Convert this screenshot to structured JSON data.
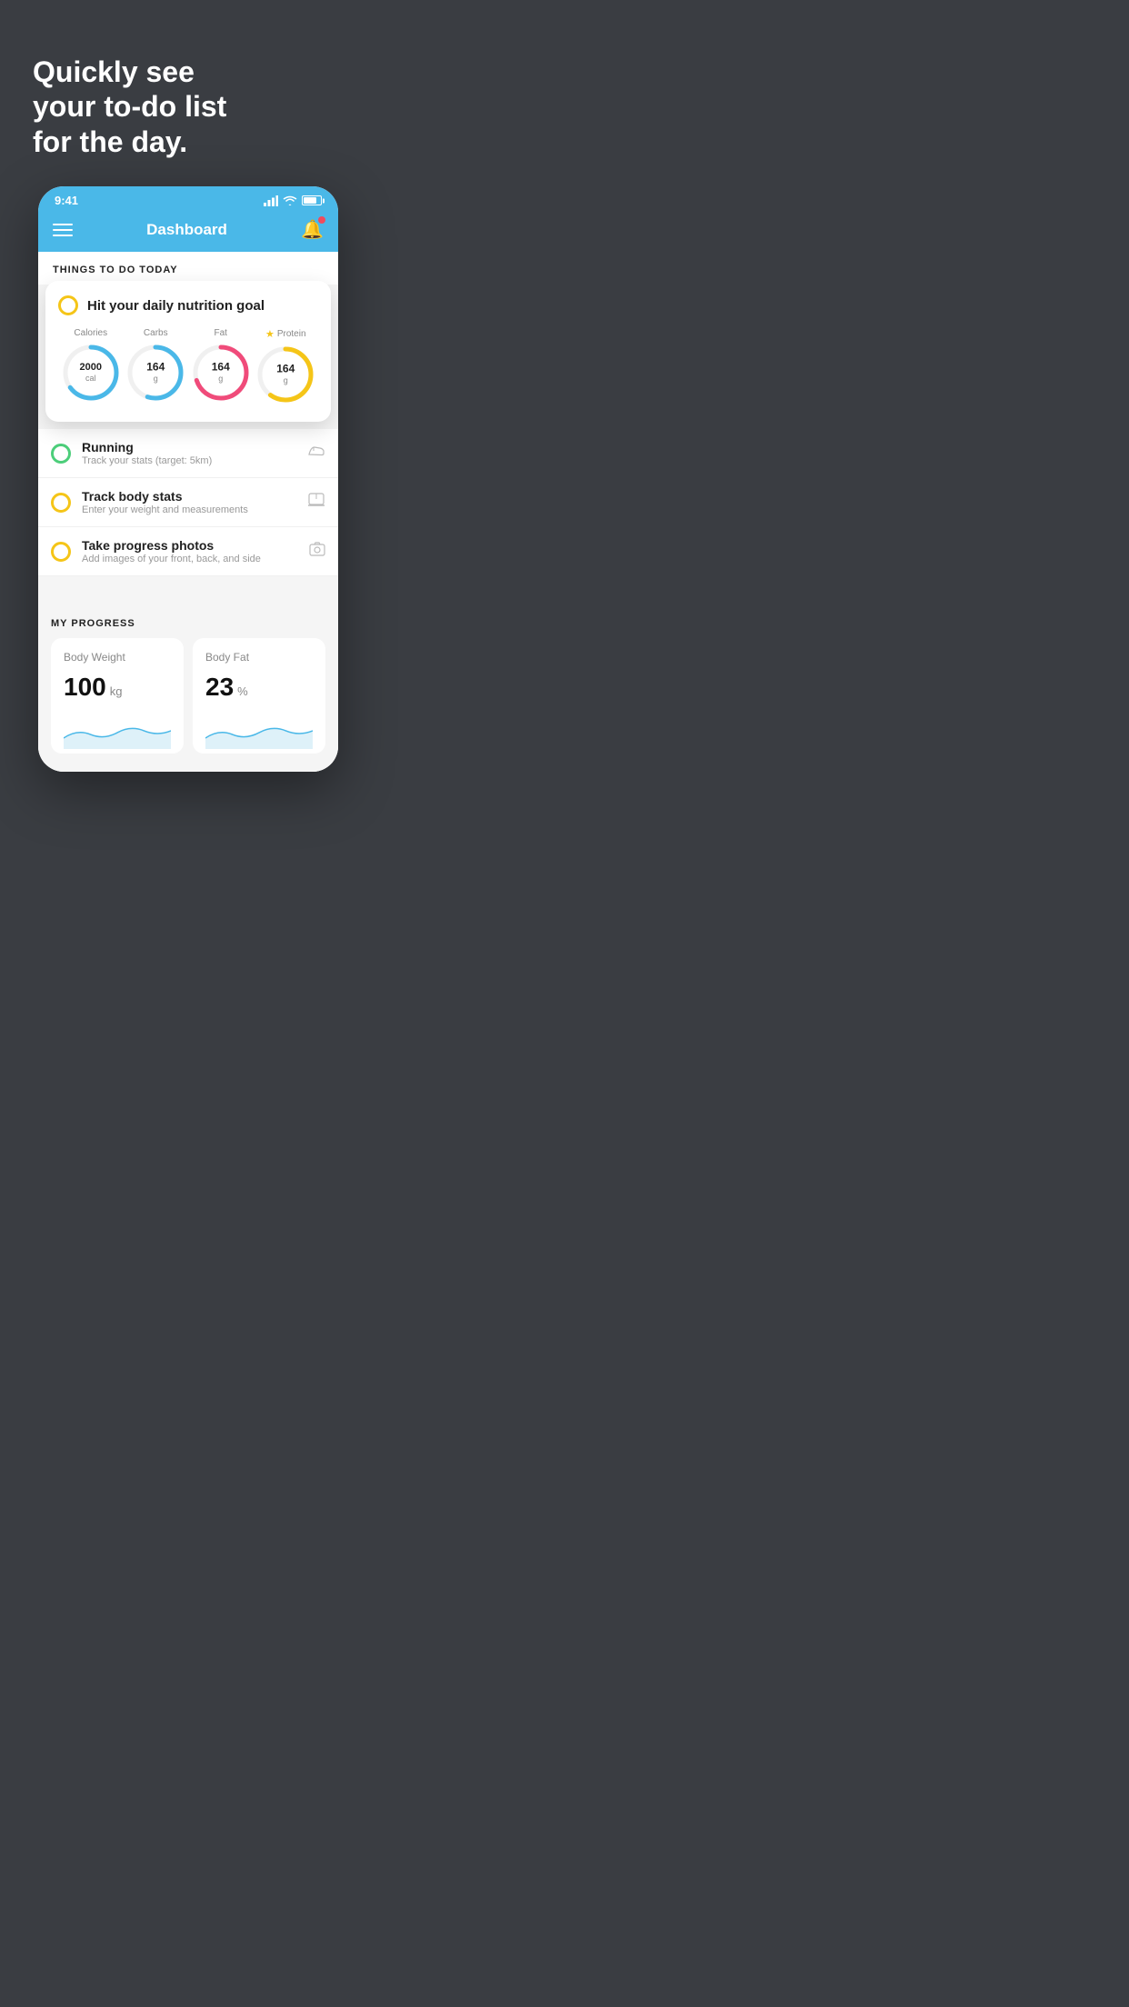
{
  "background": {
    "color": "#3a3d42"
  },
  "headline": {
    "line1": "Quickly see",
    "line2": "your to-do list",
    "line3": "for the day."
  },
  "status_bar": {
    "time": "9:41"
  },
  "nav": {
    "title": "Dashboard"
  },
  "section1": {
    "label": "THINGS TO DO TODAY"
  },
  "nutrition_card": {
    "title": "Hit your daily nutrition goal",
    "items": [
      {
        "label": "Calories",
        "value": "2000",
        "unit": "cal",
        "color": "#4ab8e8",
        "pct": 65,
        "star": false
      },
      {
        "label": "Carbs",
        "value": "164",
        "unit": "g",
        "color": "#4ab8e8",
        "pct": 55,
        "star": false
      },
      {
        "label": "Fat",
        "value": "164",
        "unit": "g",
        "color": "#f04b7a",
        "pct": 70,
        "star": false
      },
      {
        "label": "Protein",
        "value": "164",
        "unit": "g",
        "color": "#f5c518",
        "pct": 60,
        "star": true
      }
    ]
  },
  "todo_items": [
    {
      "id": "running",
      "title": "Running",
      "subtitle": "Track your stats (target: 5km)",
      "icon": "shoe",
      "circle_color": "green",
      "checked": true
    },
    {
      "id": "track-body",
      "title": "Track body stats",
      "subtitle": "Enter your weight and measurements",
      "icon": "scale",
      "circle_color": "yellow",
      "checked": false
    },
    {
      "id": "progress-photos",
      "title": "Take progress photos",
      "subtitle": "Add images of your front, back, and side",
      "icon": "photo",
      "circle_color": "yellow",
      "checked": false
    }
  ],
  "progress": {
    "section_title": "MY PROGRESS",
    "cards": [
      {
        "id": "body-weight",
        "title": "Body Weight",
        "value": "100",
        "unit": "kg"
      },
      {
        "id": "body-fat",
        "title": "Body Fat",
        "value": "23",
        "unit": "%"
      }
    ]
  }
}
